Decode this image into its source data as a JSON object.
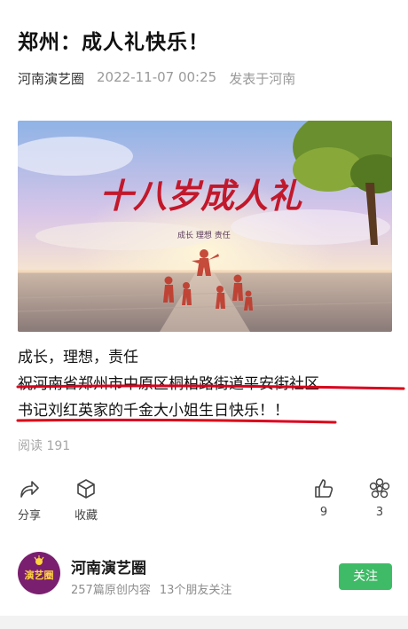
{
  "article": {
    "title": "郑州：成人礼快乐！",
    "author": "河南演艺圈",
    "datetime": "2022-11-07 00:25",
    "location": "发表于河南",
    "banner": {
      "headline": "十八岁成人礼",
      "subtitle": "成长 理想 责任"
    },
    "paragraphs": [
      "成长，理想，责任",
      "祝河南省郑州市中原区桐柏路街道平安街社区",
      "书记刘红英家的千金大小姐生日快乐！！"
    ],
    "read_count": "阅读 191"
  },
  "actions": {
    "share": "分享",
    "collect": "收藏",
    "like_count": "9",
    "wow_count": "3"
  },
  "account": {
    "avatar_text": "演艺圈",
    "name": "河南演艺圈",
    "original_count": "257篇原创内容",
    "friends_follow": "13个朋友关注",
    "follow_label": "关注"
  },
  "colors": {
    "accent_green": "#3fbb67",
    "annotation_red": "#d9001b"
  }
}
